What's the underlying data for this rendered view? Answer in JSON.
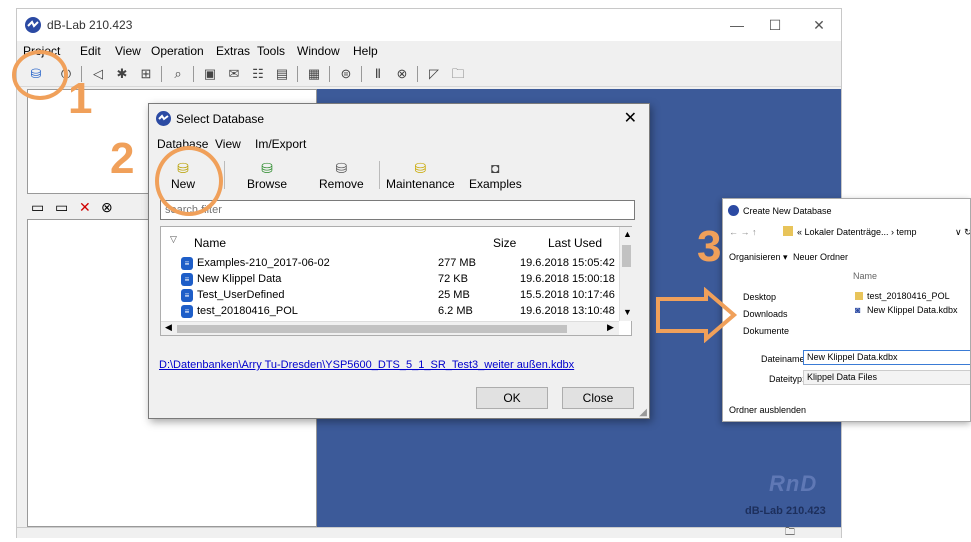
{
  "app": {
    "title": "dB-Lab 210.423",
    "menu": [
      "Project",
      "Edit",
      "View",
      "Operation",
      "Extras",
      "Tools",
      "Window",
      "Help"
    ],
    "watermark": "RnD",
    "version": "dB-Lab 210.423"
  },
  "dialog": {
    "title": "Select Database",
    "close": "✕",
    "menu": [
      "Database",
      "View",
      "Im/Export"
    ],
    "ribbon": [
      {
        "label": "New",
        "icon": "new-database-icon"
      },
      {
        "label": "Browse",
        "icon": "browse-icon"
      },
      {
        "label": "Remove",
        "icon": "remove-database-icon"
      },
      {
        "label": "Maintenance",
        "icon": "maintenance-icon"
      },
      {
        "label": "Examples",
        "icon": "examples-icon"
      }
    ],
    "filter_placeholder": "search filter",
    "columns": {
      "name": "Name",
      "size": "Size",
      "last_used": "Last Used"
    },
    "rows": [
      {
        "name": "Examples-210_2017-06-02",
        "size": "277 MB",
        "last_used": "19.6.2018 15:05:42"
      },
      {
        "name": "New Klippel Data",
        "size": "72 KB",
        "last_used": "19.6.2018 15:00:18"
      },
      {
        "name": "Test_UserDefined",
        "size": "25 MB",
        "last_used": "15.5.2018 10:17:46"
      },
      {
        "name": "test_20180416_POL",
        "size": "6.2 MB",
        "last_used": "19.6.2018 13:10:48"
      }
    ],
    "path": "D:\\Datenbanken\\Arry Tu-Dresden\\YSP5600_DTS_5_1_SR_Test3_weiter außen.kdbx",
    "ok": "OK",
    "close_button": "Close"
  },
  "annotations": {
    "step1": "1",
    "step2": "2",
    "step3": "3"
  },
  "create_dialog": {
    "title": "Create New Database",
    "breadcrumb": "« Lokaler Datenträge... › temp",
    "organize": "Organisieren ▾",
    "new_folder": "Neuer Ordner",
    "col_name": "Name",
    "nav": [
      "Desktop",
      "Downloads",
      "Dokumente"
    ],
    "files": [
      "test_20180416_POL",
      "New Klippel Data.kdbx"
    ],
    "filename_label": "Dateiname:",
    "filename_value": "New Klippel Data.kdbx",
    "filetype_label": "Dateityp:",
    "filetype_value": "Klippel Data Files",
    "hide_folders": "Ordner ausblenden"
  },
  "colors": {
    "accent": "#f0a05a",
    "desktop_blue": "#3c5a99",
    "link": "#0000cc"
  }
}
